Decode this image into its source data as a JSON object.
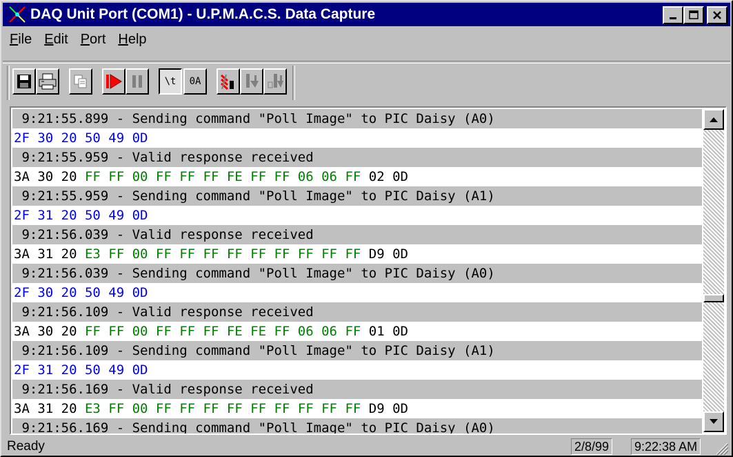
{
  "window": {
    "title": "DAQ Unit Port (COM1) - U.P.M.A.C.S. Data Capture"
  },
  "menu": [
    {
      "label": "File",
      "accel": "F",
      "rest": "ile"
    },
    {
      "label": "Edit",
      "accel": "E",
      "rest": "dit"
    },
    {
      "label": "Port",
      "accel": "P",
      "rest": "ort"
    },
    {
      "label": "Help",
      "accel": "H",
      "rest": "elp"
    }
  ],
  "toolbar": {
    "tab_label": "\\t",
    "hex_label": "0A",
    "icons": [
      "save-icon",
      "print-icon",
      "copy-icon",
      "start-capture-icon",
      "pause-icon",
      "tab-format-icon",
      "hex-format-icon",
      "poll-icon",
      "receive-icon",
      "receive-all-icon"
    ]
  },
  "log": {
    "lines": [
      {
        "type": "info",
        "text": " 9:21:55.899 - Sending command \"Poll Image\" to PIC Daisy (A0)"
      },
      {
        "type": "sent",
        "text": "2F 30 20 50 49 0D"
      },
      {
        "type": "info",
        "text": " 9:21:55.959 - Valid response received"
      },
      {
        "type": "recv",
        "head": "3A 30 20 ",
        "data": "FF FF 00 FF FF FF FE FF FF 06 06 FF",
        "tail": " 02 0D"
      },
      {
        "type": "info",
        "text": " 9:21:55.959 - Sending command \"Poll Image\" to PIC Daisy (A1)"
      },
      {
        "type": "sent",
        "text": "2F 31 20 50 49 0D"
      },
      {
        "type": "info",
        "text": " 9:21:56.039 - Valid response received"
      },
      {
        "type": "recv",
        "head": "3A 31 20 ",
        "data": "E3 FF 00 FF FF FF FF FF FF FF FF FF",
        "tail": " D9 0D"
      },
      {
        "type": "info",
        "text": " 9:21:56.039 - Sending command \"Poll Image\" to PIC Daisy (A0)"
      },
      {
        "type": "sent",
        "text": "2F 30 20 50 49 0D"
      },
      {
        "type": "info",
        "text": " 9:21:56.109 - Valid response received"
      },
      {
        "type": "recv",
        "head": "3A 30 20 ",
        "data": "FF FF 00 FF FF FF FE FE FF 06 06 FF",
        "tail": " 01 0D"
      },
      {
        "type": "info",
        "text": " 9:21:56.109 - Sending command \"Poll Image\" to PIC Daisy (A1)"
      },
      {
        "type": "sent",
        "text": "2F 31 20 50 49 0D"
      },
      {
        "type": "info",
        "text": " 9:21:56.169 - Valid response received"
      },
      {
        "type": "recv",
        "head": "3A 31 20 ",
        "data": "E3 FF 00 FF FF FF FF FF FF FF FF FF",
        "tail": " D9 0D"
      },
      {
        "type": "info",
        "text": " 9:21:56.169 - Sending command \"Poll Image\" to PIC Daisy (A0)"
      }
    ],
    "scroll_position": 0.6
  },
  "status": {
    "text": "Ready",
    "date": "2/8/99",
    "time": "9:22:38 AM"
  },
  "colors": {
    "title_bar": "#000080",
    "sent_text": "#0000ff",
    "data_bytes": "#008000",
    "info_row": "#c0c0c0"
  }
}
